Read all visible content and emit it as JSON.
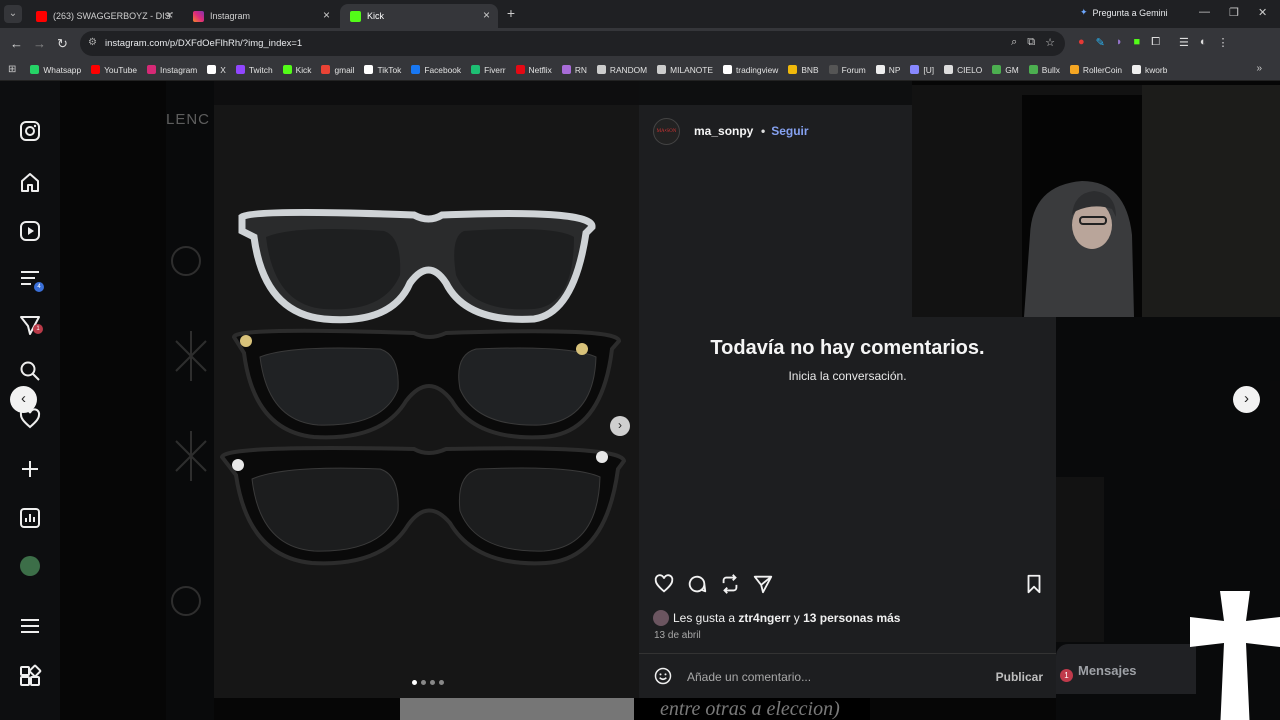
{
  "browser": {
    "tabs": [
      {
        "title": "(263) SWAGGERBOYZ - DISTINT",
        "icon": "youtube-icon",
        "color": "#ff0000",
        "active": false
      },
      {
        "title": "Instagram",
        "icon": "instagram-icon",
        "color": "#d62976",
        "active": false
      },
      {
        "title": "Kick",
        "icon": "kick-icon",
        "color": "#53fc18",
        "active": true
      }
    ],
    "gemini_label": "Pregunta a Gemini",
    "url": "instagram.com/p/DXFdOeFlhRh/?img_index=1",
    "bookmarks": [
      {
        "label": "Whatsapp",
        "color": "#25d366"
      },
      {
        "label": "YouTube",
        "color": "#ff0000"
      },
      {
        "label": "Instagram",
        "color": "#d62976"
      },
      {
        "label": "X",
        "color": "#ffffff"
      },
      {
        "label": "Twitch",
        "color": "#9146ff"
      },
      {
        "label": "Kick",
        "color": "#53fc18"
      },
      {
        "label": "gmail",
        "color": "#ea4335"
      },
      {
        "label": "TikTok",
        "color": "#ffffff"
      },
      {
        "label": "Facebook",
        "color": "#1877f2"
      },
      {
        "label": "Fiverr",
        "color": "#1dbf73"
      },
      {
        "label": "Netflix",
        "color": "#e50914"
      },
      {
        "label": "RN",
        "color": "#a86cd8"
      },
      {
        "label": "RANDOM",
        "color": "#cccccc"
      },
      {
        "label": "MILANOTE",
        "color": "#cccccc"
      },
      {
        "label": "tradingview",
        "color": "#ffffff"
      },
      {
        "label": "BNB",
        "color": "#f0b90b"
      },
      {
        "label": "Forum",
        "color": "#555555"
      },
      {
        "label": "NP",
        "color": "#eeeeee"
      },
      {
        "label": "[U]",
        "color": "#8888ff"
      },
      {
        "label": "CIELO",
        "color": "#dddddd"
      },
      {
        "label": "GM",
        "color": "#4caf50"
      },
      {
        "label": "Bullx",
        "color": "#4caf50"
      },
      {
        "label": "RollerCoin",
        "color": "#f5a623"
      },
      {
        "label": "kworb",
        "color": "#eeeeee"
      }
    ]
  },
  "post": {
    "username": "ma_sonpy",
    "avatar_text": "MA•SON",
    "separator": "•",
    "follow_label": "Seguir",
    "empty_title": "Todavía no hay comentarios.",
    "empty_subtitle": "Inicia la conversación.",
    "likes_prefix": "Les gusta a",
    "likes_user": "ztr4ngerr",
    "likes_mid": "y",
    "likes_others": "13 personas más",
    "date": "13 de abril",
    "comment_placeholder": "Añade un comentario...",
    "publish_label": "Publicar",
    "image_dots": 4,
    "active_dot": 0
  },
  "sidebar_badges": {
    "reels": "4",
    "messages": "1"
  },
  "messages_widget": {
    "label": "Mensajes",
    "badge": "1"
  },
  "background_text": "entre otras a eleccion)",
  "background_fragment": "LENC"
}
